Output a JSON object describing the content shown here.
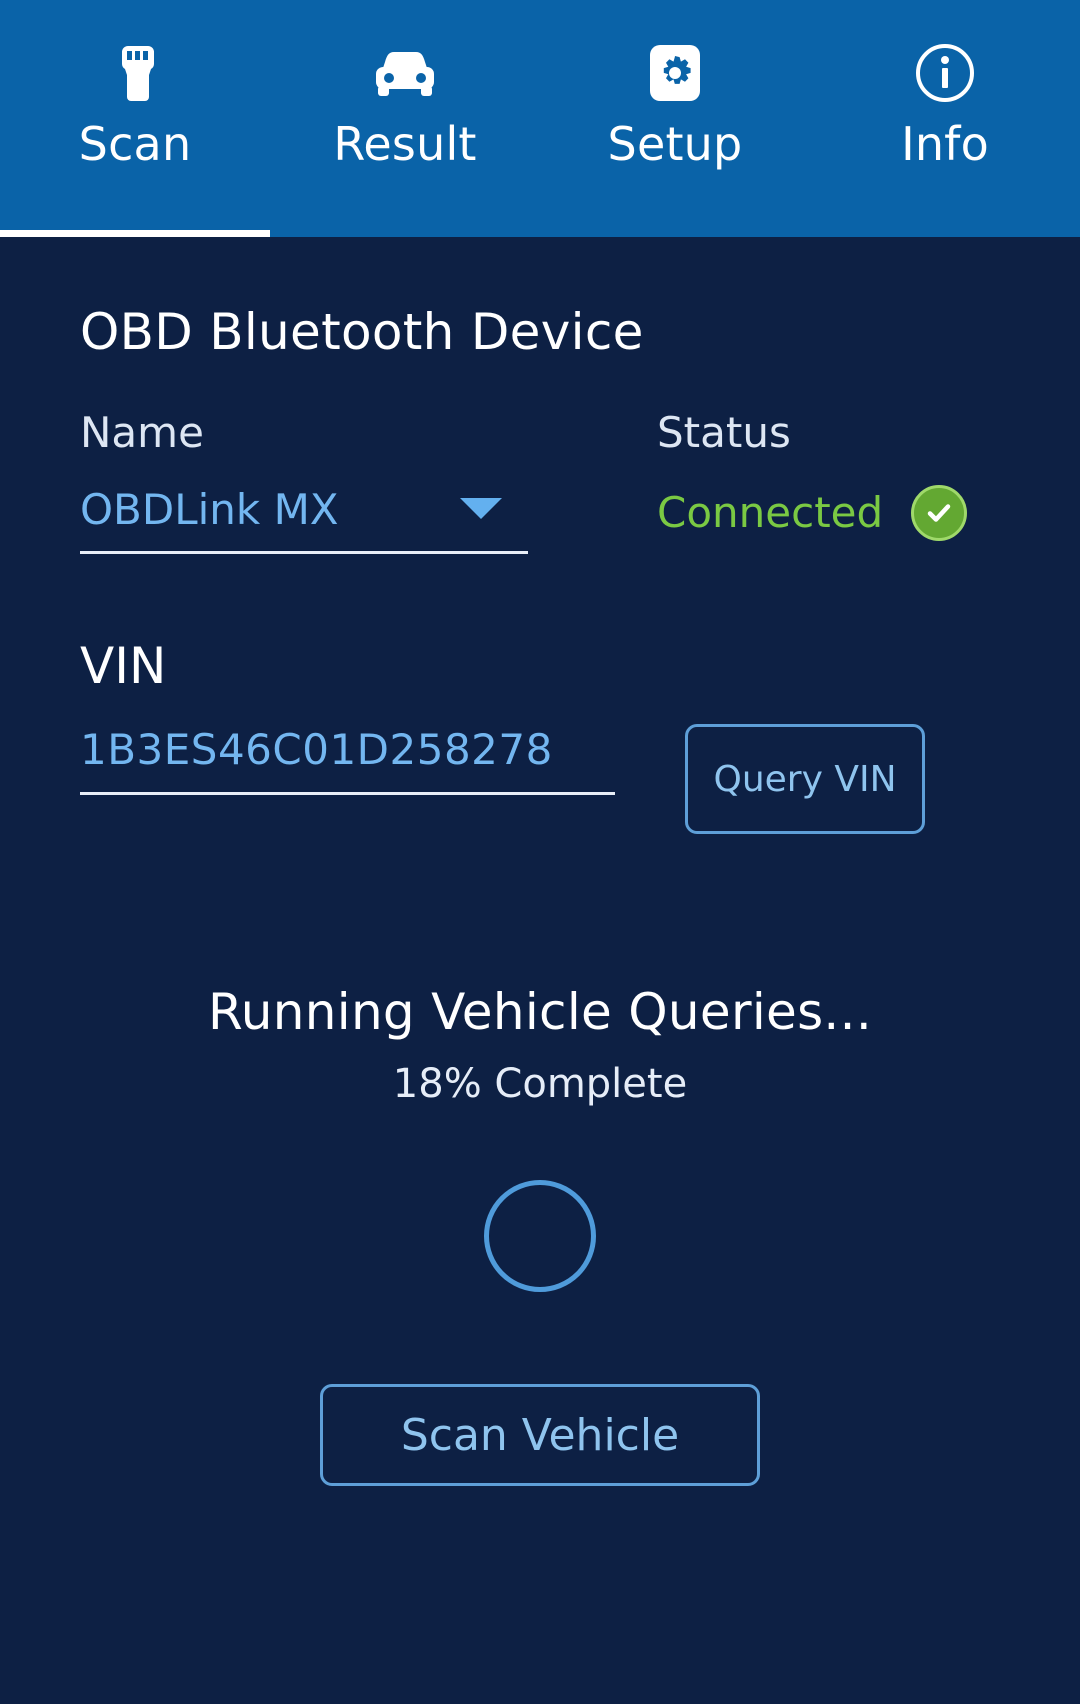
{
  "tabs": [
    {
      "label": "Scan",
      "icon": "obd-plug-icon",
      "active": true
    },
    {
      "label": "Result",
      "icon": "car-icon",
      "active": false
    },
    {
      "label": "Setup",
      "icon": "gear-icon",
      "active": false
    },
    {
      "label": "Info",
      "icon": "info-icon",
      "active": false
    }
  ],
  "device": {
    "section_title": "OBD Bluetooth Device",
    "name_label": "Name",
    "name_value": "OBDLink MX",
    "status_label": "Status",
    "status_value": "Connected",
    "status_icon": "check-circle-icon"
  },
  "vin": {
    "label": "VIN",
    "value": "1B3ES46C01D258278",
    "query_button_label": "Query VIN"
  },
  "progress": {
    "title": "Running Vehicle Queries...",
    "subtitle": "18% Complete",
    "percent": 18,
    "spinner_icon": "loading-spinner-icon"
  },
  "actions": {
    "scan_button_label": "Scan Vehicle"
  },
  "colors": {
    "tabbar_bg": "#0a63a8",
    "page_bg": "#0d2044",
    "accent_blue": "#73b6f0",
    "status_green": "#7ac943",
    "text_white": "#ffffff"
  }
}
